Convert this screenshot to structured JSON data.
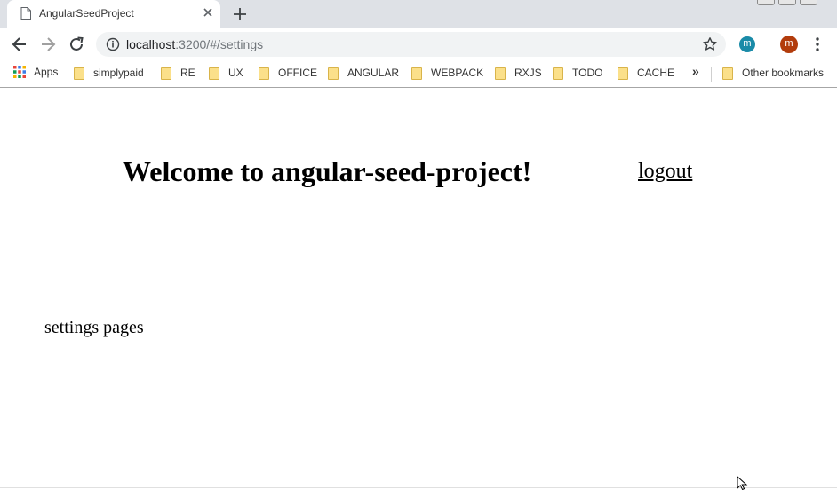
{
  "browser": {
    "tab": {
      "title": "AngularSeedProject",
      "icon": "page-icon",
      "close_icon": "close-icon"
    },
    "new_tab_icon": "plus-icon",
    "toolbar": {
      "back_icon": "back-arrow-icon",
      "forward_icon": "forward-arrow-icon",
      "reload_icon": "reload-icon",
      "url_host": "localhost",
      "url_rest": ":3200/#/settings",
      "info_icon": "info-icon",
      "star_icon": "star-icon",
      "extension_letter": "m",
      "extension_color": "#1a8ba8",
      "profile_letter": "m",
      "profile_color": "#b23c0c",
      "menu_icon": "three-dots-icon"
    },
    "bookmarks": {
      "apps_label": "Apps",
      "items": [
        {
          "label": "simplypaid"
        },
        {
          "label": "RE"
        },
        {
          "label": "UX"
        },
        {
          "label": "OFFICE"
        },
        {
          "label": "ANGULAR"
        },
        {
          "label": "WEBPACK"
        },
        {
          "label": "RXJS"
        },
        {
          "label": "TODO"
        },
        {
          "label": "CACHE"
        }
      ],
      "overflow_label": "»",
      "other_label": "Other bookmarks"
    }
  },
  "page": {
    "heading": "Welcome to angular-seed-project!",
    "logout_label": "logout",
    "content_text": "settings pages"
  }
}
